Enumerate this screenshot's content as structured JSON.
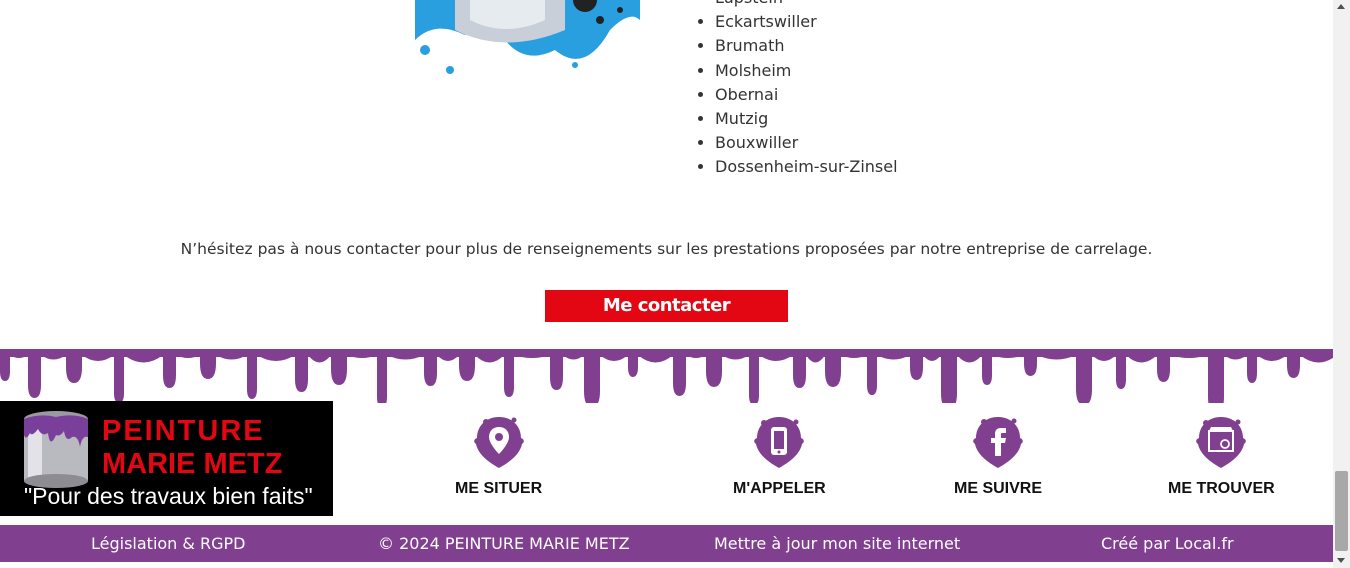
{
  "cities": [
    "Lupstein",
    "Eckartswiller",
    "Brumath",
    "Molsheim",
    "Obernai",
    "Mutzig",
    "Bouxwiller",
    "Dossenheim-sur-Zinsel"
  ],
  "contact": {
    "text": "N’hésitez pas à nous contacter pour plus de renseignements sur les prestations proposées par notre entreprise de carrelage.",
    "button_label": "Me contacter"
  },
  "logo": {
    "line1": "PEINTURE",
    "line2": "MARIE METZ",
    "slogan": "\"Pour des travaux bien faits\""
  },
  "footer_items": {
    "situer": "ME SITUER",
    "appeler": "M'APPELER",
    "suivre": "ME SUIVRE",
    "trouver": "ME TROUVER"
  },
  "bottom_bar": {
    "legal": "Législation & RGPD",
    "copyright": "© 2024 PEINTURE MARIE METZ",
    "update": "Mettre à jour mon site internet",
    "credit": "Créé par Local.fr"
  },
  "colors": {
    "accent_red": "#e30613",
    "brand_purple": "#813f90"
  },
  "icons": [
    "location-pin-icon",
    "phone-icon",
    "facebook-icon",
    "google-business-icon"
  ]
}
